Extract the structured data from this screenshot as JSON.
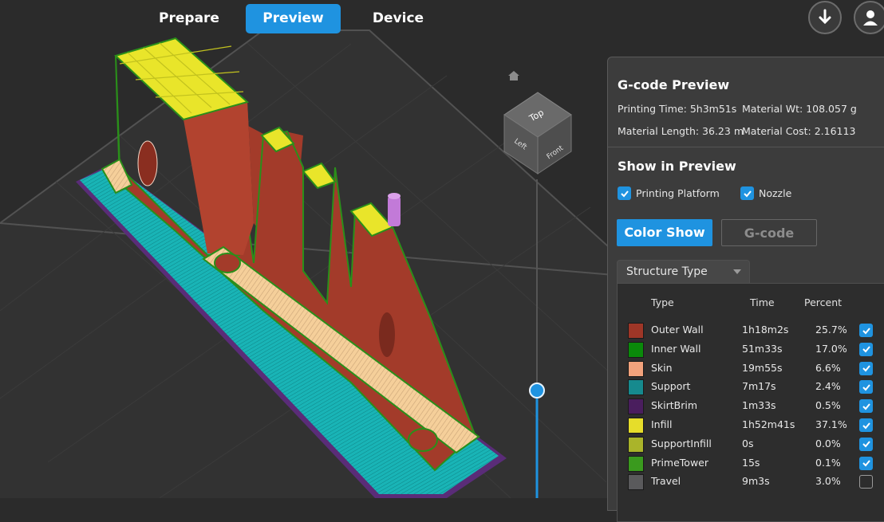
{
  "tabs": [
    {
      "label": "Prepare",
      "active": false
    },
    {
      "label": "Preview",
      "active": true
    },
    {
      "label": "Device",
      "active": false
    }
  ],
  "toolbar": {
    "download_icon": "download-icon",
    "user_icon": "user-icon"
  },
  "view_cube": {
    "top": "Top",
    "left": "Left",
    "front": "Front"
  },
  "panel": {
    "title": "G-code Preview",
    "printing_time": "Printing Time: 5h3m51s",
    "material_wt": "Material Wt: 108.057 g",
    "material_length": "Material Length: 36.23 m",
    "material_cost": "Material Cost: 2.16113",
    "show_title": "Show in Preview",
    "show_options": [
      {
        "label": "Printing Platform",
        "checked": true
      },
      {
        "label": "Nozzle",
        "checked": true
      }
    ],
    "color_show_label": "Color Show",
    "gcode_label": "G-code",
    "dropdown_label": "Structure Type",
    "headers": {
      "type": "Type",
      "time": "Time",
      "percent": "Percent"
    },
    "rows": [
      {
        "type": "Outer Wall",
        "time": "1h18m2s",
        "percent": "25.7%",
        "color": "#9e3627",
        "checked": true
      },
      {
        "type": "Inner Wall",
        "time": "51m33s",
        "percent": "17.0%",
        "color": "#0a8a0a",
        "checked": true
      },
      {
        "type": "Skin",
        "time": "19m55s",
        "percent": "6.6%",
        "color": "#f2a27c",
        "checked": true
      },
      {
        "type": "Support",
        "time": "7m17s",
        "percent": "2.4%",
        "color": "#168a8e",
        "checked": true
      },
      {
        "type": "SkirtBrim",
        "time": "1m33s",
        "percent": "0.5%",
        "color": "#4a1e5e",
        "checked": true
      },
      {
        "type": "Infill",
        "time": "1h52m41s",
        "percent": "37.1%",
        "color": "#e6dd2a",
        "checked": true
      },
      {
        "type": "SupportInfill",
        "time": "0s",
        "percent": "0.0%",
        "color": "#aab42a",
        "checked": true
      },
      {
        "type": "PrimeTower",
        "time": "15s",
        "percent": "0.1%",
        "color": "#3a9a1e",
        "checked": true
      },
      {
        "type": "Travel",
        "time": "9m3s",
        "percent": "3.0%",
        "color": "#5a5a5c",
        "checked": false
      }
    ]
  },
  "colors": {
    "accent": "#1f93e0",
    "panel_bg": "#3c3c3c",
    "viewport_bg": "#2b2b2b"
  }
}
